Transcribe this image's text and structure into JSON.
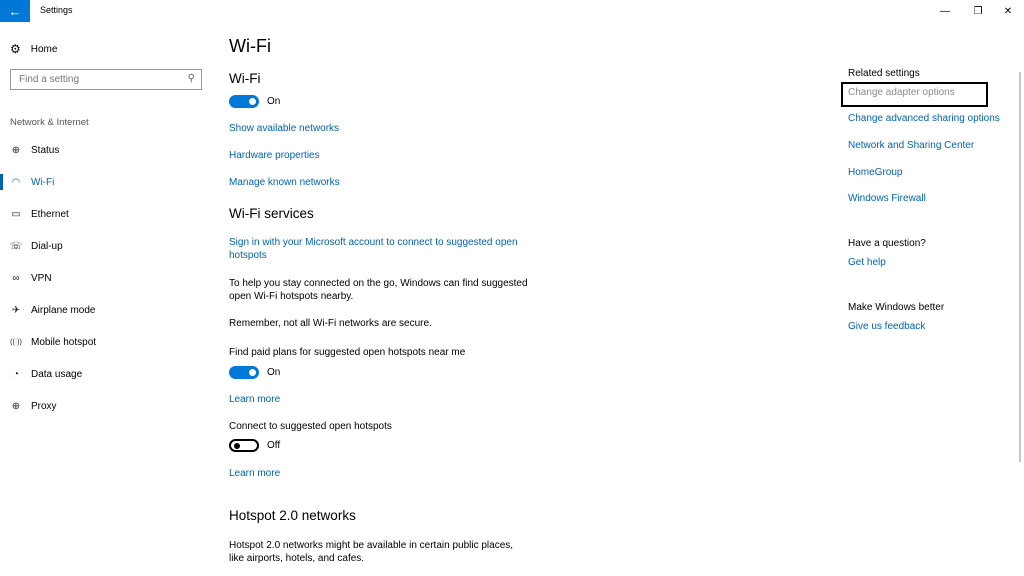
{
  "window": {
    "title": "Settings",
    "back_icon": "arrow-left-icon",
    "controls": {
      "minimize": "—",
      "maximize": "❐",
      "close": "✕"
    },
    "accent": "#0078d7"
  },
  "sidebar": {
    "home_label": "Home",
    "search_placeholder": "Find a setting",
    "section_label": "Network & Internet",
    "items": [
      {
        "label": "Status",
        "icon": "globe-icon",
        "glyph": "⊕"
      },
      {
        "label": "Wi-Fi",
        "icon": "wifi-icon",
        "glyph": "◠",
        "active": true
      },
      {
        "label": "Ethernet",
        "icon": "ethernet-icon",
        "glyph": "▭"
      },
      {
        "label": "Dial-up",
        "icon": "dialup-icon",
        "glyph": "☏"
      },
      {
        "label": "VPN",
        "icon": "vpn-icon",
        "glyph": "∞"
      },
      {
        "label": "Airplane mode",
        "icon": "airplane-icon",
        "glyph": "✈"
      },
      {
        "label": "Mobile hotspot",
        "icon": "hotspot-icon",
        "glyph": "((·))"
      },
      {
        "label": "Data usage",
        "icon": "data-usage-icon",
        "glyph": "◔"
      },
      {
        "label": "Proxy",
        "icon": "proxy-icon",
        "glyph": "⊕"
      }
    ]
  },
  "main": {
    "page_title": "Wi-Fi",
    "wifi_heading": "Wi-Fi",
    "wifi_toggle_state": "On",
    "links": {
      "show_networks": "Show available networks",
      "hardware": "Hardware properties",
      "manage_known": "Manage known networks"
    },
    "services_heading": "Wi-Fi services",
    "sign_in_link_line1": "Sign in with your Microsoft account to connect to suggested open",
    "sign_in_link_line2": "hotspots",
    "help_text_line1": "To help you stay connected on the go, Windows can find suggested",
    "help_text_line2": "open Wi-Fi hotspots nearby.",
    "remember_text": "Remember, not all Wi-Fi networks are secure.",
    "paid_plans_label": "Find paid plans for suggested open hotspots near me",
    "paid_plans_state": "On",
    "learn_more_1": "Learn more",
    "connect_label": "Connect to suggested open hotspots",
    "connect_state": "Off",
    "learn_more_2": "Learn more",
    "hotspot20_heading": "Hotspot 2.0 networks",
    "hotspot20_text_line1": "Hotspot 2.0 networks might be available in certain public places,",
    "hotspot20_text_line2": "like airports, hotels, and cafes."
  },
  "related": {
    "heading": "Related settings",
    "links": [
      "Change adapter options",
      "Change advanced sharing options",
      "Network and Sharing Center",
      "HomeGroup",
      "Windows Firewall"
    ],
    "question_heading": "Have a question?",
    "get_help": "Get help",
    "better_heading": "Make Windows better",
    "feedback": "Give us feedback"
  }
}
